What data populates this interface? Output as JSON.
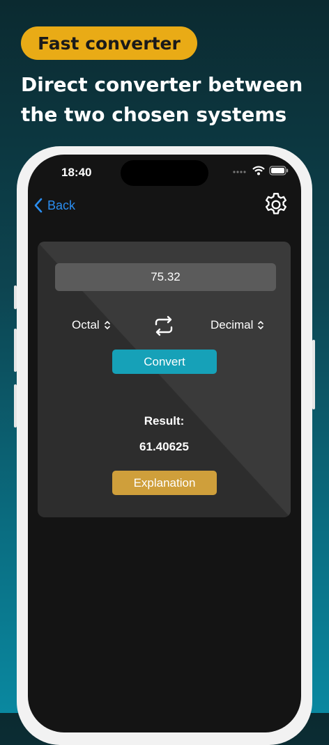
{
  "promo": {
    "badge": "Fast converter",
    "headline": "Direct converter between the two chosen systems"
  },
  "status_bar": {
    "time": "18:40"
  },
  "nav": {
    "back_label": "Back"
  },
  "converter": {
    "input_value": "75.32",
    "from_system": "Octal",
    "to_system": "Decimal",
    "convert_label": "Convert",
    "result_label": "Result:",
    "result_value": "61.40625",
    "explanation_label": "Explanation"
  },
  "colors": {
    "badge": "#e9ab16",
    "convert": "#16a1b8",
    "explanation": "#cf9f3b",
    "link": "#2b8ef0"
  },
  "icons": [
    "chevron-left-icon",
    "gear-icon",
    "swap-icon",
    "chevron-updown-icon",
    "wifi-icon",
    "battery-icon",
    "cellular-icon"
  ]
}
